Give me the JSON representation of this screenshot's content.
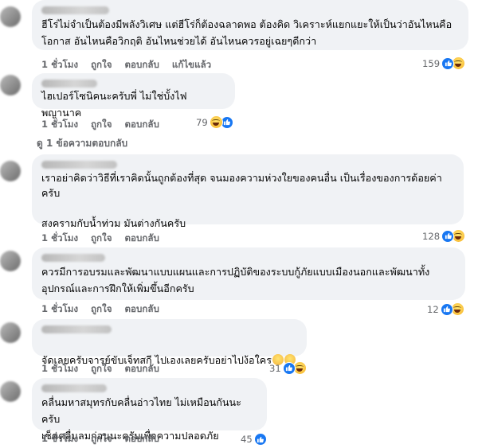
{
  "comments": [
    {
      "text": "ฮีโร่ไม่จำเป็นต้องมีพลังวิเศษ แต่ฮีโร่ก็ต้องฉลาดพอ ต้องคิด วิเคราะห์แยกแยะให้เป็นว่าอันไหนคือ\nโอกาส อันไหนคือวิกฤติ อันไหนช่วยได้ อันไหนควรอยู่เฉยๆดีกว่า",
      "time": "1 ชั่วโมง",
      "like": "ถูกใจ",
      "reply": "ตอบกลับ",
      "edited": "แก้ไขแล้ว",
      "reactions": "159",
      "reaction_icons": [
        "like-icon",
        "haha-icon"
      ]
    },
    {
      "text": "ไฮเปอร์โซนิคนะครับพี่ ไม่ใช่บั้งไฟพญานาค",
      "time": "1 ชั่วโมง",
      "like": "ถูกใจ",
      "reply": "ตอบกลับ",
      "reactions": "79",
      "reaction_icons": [
        "haha-icon",
        "like-icon"
      ],
      "replies_link": "ดู 1 ข้อความตอบกลับ"
    },
    {
      "text": "เราอย่าคิดว่าวิธีที่เราคิดนั้นถูกต้องที่สุด จนมองความห่วงใยของคนอื่น เป็นเรื่องของการด้อยค่า\nครับ\n\nสงครามกับน้ำท่วม มันต่างกันครับ",
      "time": "1 ชั่วโมง",
      "like": "ถูกใจ",
      "reply": "ตอบกลับ",
      "reactions": "128",
      "reaction_icons": [
        "like-icon",
        "haha-icon"
      ]
    },
    {
      "text": "ควรมีการอบรมและพัฒนาแบบแผนและการปฏิบัติของระบบกู้ภัยแบบเมืองนอกและพัฒนาทั้ง\nอุปกรณ์และการฝึกให้เพิ่มขึ้นอีกครับ",
      "time": "1 ชั่วโมง",
      "like": "ถูกใจ",
      "reply": "ตอบกลับ",
      "reactions": "12",
      "reaction_icons": [
        "like-icon",
        "haha-icon"
      ]
    },
    {
      "text": "จัดเลยครับจารย์ขับเจ็ทสกี ไปเองเลยครับอย่าไปง้อใคร",
      "inline_emoji": [
        "grin-emoji",
        "grin-emoji"
      ],
      "time": "1 ชั่วโมง",
      "like": "ถูกใจ",
      "reply": "ตอบกลับ",
      "reactions": "31",
      "reaction_icons": [
        "like-icon",
        "haha-icon"
      ]
    },
    {
      "text": "คลื่นมหาสมุทรกับคลื่นอ่าวไทย ไม่เหมือนกันนะครับ\nเช็คคลื่นลมก่อนนะครับเพื่อความปลอดภัย",
      "time": "1 ชั่วโมง",
      "like": "ถูกใจ",
      "reply": "ตอบกลับ",
      "reactions": "45",
      "reaction_icons": [
        "like-icon"
      ]
    }
  ],
  "colors": {
    "bubble": "#f0f2f5",
    "meta": "#65676b",
    "like_blue": "#1877f2"
  }
}
